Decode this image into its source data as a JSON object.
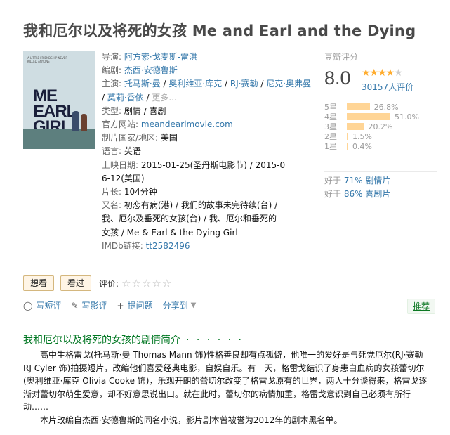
{
  "title": "我和厄尔以及将死的女孩 Me and Earl and the Dying",
  "poster": {
    "tagline": "A LITTLE FRIENDSHIP NEVER KILLED ANYONE",
    "line1": "ME",
    "line2": "EARL",
    "line3": "GIRL"
  },
  "info": {
    "director_label": "导演:",
    "director": "阿方索·戈麦斯-雷洪",
    "writer_label": "编剧:",
    "writer": "杰西·安德鲁斯",
    "cast_label": "主演:",
    "cast": [
      "托马斯·曼",
      "奥利维亚·库克",
      "RJ·赛勒",
      "尼克·奥弗曼",
      "莫莉·香侬"
    ],
    "more": "更多...",
    "genre_label": "类型:",
    "genre": "剧情 / 喜剧",
    "site_label": "官方网站:",
    "site": "meandearlmovie.com",
    "country_label": "制片国家/地区:",
    "country": "美国",
    "language_label": "语言:",
    "language": "英语",
    "release_label": "上映日期:",
    "release_line1": "2015-01-25(圣丹斯电影节) / 2015-0",
    "release_line2": "6-12(美国)",
    "runtime_label": "片长:",
    "runtime": "104分钟",
    "aka_label": "又名:",
    "aka_line1": "初恋有病(港) / 我们的故事未完待续(台) /",
    "aka_line2": "我、厄尔及垂死的女孩(台) / 我、厄尔和垂死的",
    "aka_line3": "女孩 / Me & Earl & the Dying Girl",
    "imdb_label": "IMDb链接:",
    "imdb": "tt2582496"
  },
  "rating": {
    "label": "豆瓣评分",
    "score": "8.0",
    "stars_full": "★★★★",
    "stars_empty": "★",
    "votes": "30157人评价",
    "distribution": [
      {
        "label": "5星",
        "pct": "26.8%",
        "value": 26.8
      },
      {
        "label": "4星",
        "pct": "51.0%",
        "value": 51.0
      },
      {
        "label": "3星",
        "pct": "20.2%",
        "value": 20.2
      },
      {
        "label": "2星",
        "pct": "1.5%",
        "value": 1.5
      },
      {
        "label": "1星",
        "pct": "0.4%",
        "value": 0.4
      }
    ],
    "better1_prefix": "好于 ",
    "better1_link": "71% 剧情片",
    "better2_prefix": "好于 ",
    "better2_link": "86% 喜剧片"
  },
  "actions": {
    "want": "想看",
    "seen": "看过",
    "rate_label": "评价:",
    "rate_stars": "☆☆☆☆☆"
  },
  "toolbar": {
    "short_review": "写短评",
    "review": "写影评",
    "question": "提问题",
    "share": "分享到",
    "recommend": "推荐"
  },
  "summary": {
    "title": "我和厄尔以及将死的女孩的剧情简介",
    "dots": "· · · · · ·",
    "p1": "高中生格雷戈(托马斯·曼 Thomas Mann 饰)性格善良却有点孤僻，他唯一的爱好是与死党厄尔(RJ·赛勒 RJ Cyler 饰)拍摄短片，改编他们喜爱经典电影，自娱自乐。有一天，格雷戈结识了身患白血病的女孩蕾切尔(奥利维亚·库克 Olivia Cooke 饰)，乐观开朗的蕾切尔改变了格雷戈原有的世界，两人十分谈得来，格雷戈逐渐对蕾切尔萌生爱意，却不好意思说出口。就在此时，蕾切尔的病情加重，格雷戈意识到自己必须有所行动……",
    "p2": "本片改编自杰西·安德鲁斯的同名小说，影片剧本曾被誉为2012年的剧本黑名单。"
  }
}
